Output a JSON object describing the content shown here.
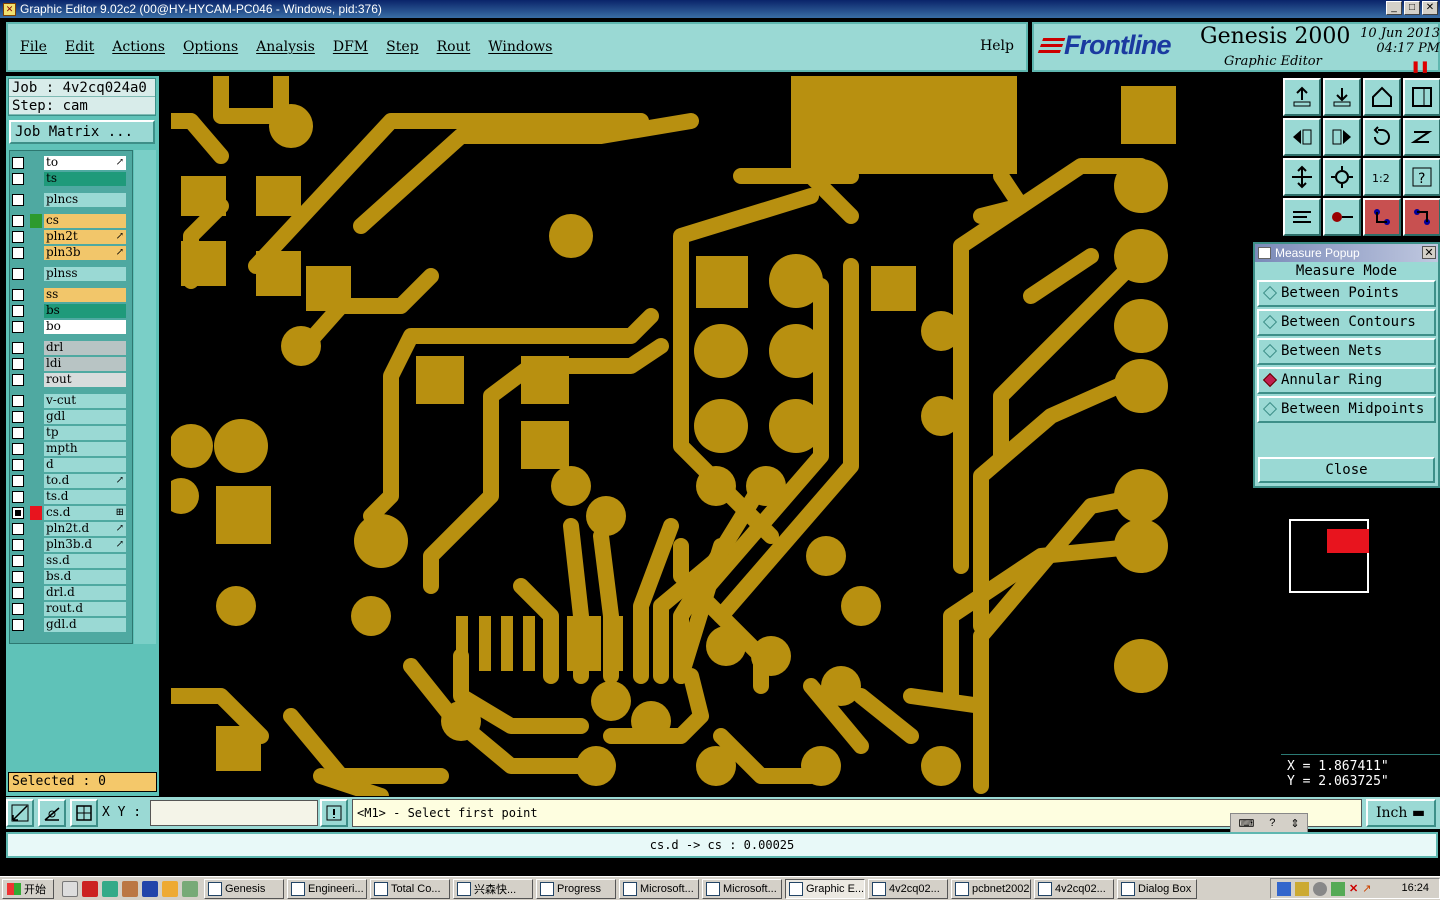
{
  "window": {
    "title": "Graphic Editor 9.02c2 (00@HY-HYCAM-PC046 - Windows, pid:376)"
  },
  "menu": {
    "items": [
      "File",
      "Edit",
      "Actions",
      "Options",
      "Analysis",
      "DFM",
      "Step",
      "Rout",
      "Windows"
    ],
    "help": "Help"
  },
  "brand": {
    "logo": "Frontline",
    "product": "Genesis 2000",
    "subtitle": "Graphic Editor",
    "date": "10 Jun 2013",
    "time": "04:17 PM"
  },
  "job": {
    "job_label": "Job : 4v2cq024a0",
    "step_label": "Step: cam",
    "matrix_button": "Job Matrix ..."
  },
  "layers": [
    {
      "name": "to",
      "color": "#ffffff",
      "checked": false,
      "swatch": "",
      "arrow": "↗"
    },
    {
      "name": "ts",
      "color": "#1f9a7a",
      "checked": false,
      "swatch": "",
      "arrow": ""
    },
    {
      "name": "plncs",
      "color": "#9ad9d4",
      "checked": false,
      "swatch": "",
      "arrow": ""
    },
    {
      "name": "cs",
      "color": "#f2c66a",
      "checked": false,
      "swatch": "#2d9a2d",
      "arrow": ""
    },
    {
      "name": "pln2t",
      "color": "#f2c66a",
      "checked": false,
      "swatch": "",
      "arrow": "↗"
    },
    {
      "name": "pln3b",
      "color": "#f2c66a",
      "checked": false,
      "swatch": "",
      "arrow": "↗"
    },
    {
      "name": "plnss",
      "color": "#9ad9d4",
      "checked": false,
      "swatch": "",
      "arrow": ""
    },
    {
      "name": "ss",
      "color": "#f2c66a",
      "checked": false,
      "swatch": "",
      "arrow": ""
    },
    {
      "name": "bs",
      "color": "#1f9a7a",
      "checked": false,
      "swatch": "",
      "arrow": ""
    },
    {
      "name": "bo",
      "color": "#ffffff",
      "checked": false,
      "swatch": "",
      "arrow": ""
    },
    {
      "name": "drl",
      "color": "#b8c4c4",
      "checked": false,
      "swatch": "",
      "arrow": ""
    },
    {
      "name": "ldi",
      "color": "#b8c4c4",
      "checked": false,
      "swatch": "",
      "arrow": ""
    },
    {
      "name": "rout",
      "color": "#d8dcdc",
      "checked": false,
      "swatch": "",
      "arrow": ""
    },
    {
      "name": "v-cut",
      "color": "#9ad9d4",
      "checked": false,
      "swatch": "",
      "arrow": ""
    },
    {
      "name": "gdl",
      "color": "#9ad9d4",
      "checked": false,
      "swatch": "",
      "arrow": ""
    },
    {
      "name": "tp",
      "color": "#9ad9d4",
      "checked": false,
      "swatch": "",
      "arrow": ""
    },
    {
      "name": "mpth",
      "color": "#9ad9d4",
      "checked": false,
      "swatch": "",
      "arrow": ""
    },
    {
      "name": "d",
      "color": "#9ad9d4",
      "checked": false,
      "swatch": "",
      "arrow": ""
    },
    {
      "name": "to.d",
      "color": "#9ad9d4",
      "checked": false,
      "swatch": "",
      "arrow": "↗"
    },
    {
      "name": "ts.d",
      "color": "#9ad9d4",
      "checked": false,
      "swatch": "",
      "arrow": ""
    },
    {
      "name": "cs.d",
      "color": "#9ad9d4",
      "checked": true,
      "swatch": "#e8141e",
      "arrow": "⊞"
    },
    {
      "name": "pln2t.d",
      "color": "#9ad9d4",
      "checked": false,
      "swatch": "",
      "arrow": "↗"
    },
    {
      "name": "pln3b.d",
      "color": "#9ad9d4",
      "checked": false,
      "swatch": "",
      "arrow": "↗"
    },
    {
      "name": "ss.d",
      "color": "#9ad9d4",
      "checked": false,
      "swatch": "",
      "arrow": ""
    },
    {
      "name": "bs.d",
      "color": "#9ad9d4",
      "checked": false,
      "swatch": "",
      "arrow": ""
    },
    {
      "name": "drl.d",
      "color": "#9ad9d4",
      "checked": false,
      "swatch": "",
      "arrow": ""
    },
    {
      "name": "rout.d",
      "color": "#9ad9d4",
      "checked": false,
      "swatch": "",
      "arrow": ""
    },
    {
      "name": "gdl.d",
      "color": "#9ad9d4",
      "checked": false,
      "swatch": "",
      "arrow": ""
    }
  ],
  "selected": "Selected : 0",
  "measure_popup": {
    "title": "Measure Popup",
    "heading": "Measure Mode",
    "options": [
      {
        "label": "Between Points",
        "selected": false
      },
      {
        "label": "Between Contours",
        "selected": false
      },
      {
        "label": "Between Nets",
        "selected": false
      },
      {
        "label": "Annular Ring",
        "selected": true
      },
      {
        "label": "Between Midpoints",
        "selected": false
      }
    ],
    "close": "Close"
  },
  "coords": {
    "x": "X = 1.867411\"",
    "y": "Y = 2.063725\""
  },
  "bottom": {
    "xy_label": "X Y :",
    "xy_value": "",
    "prompt": "<M1> - Select first point",
    "unit": "Inch"
  },
  "status_line": "cs.d -> cs : 0.00025",
  "taskbar": {
    "start": "开始",
    "items": [
      {
        "label": "Genesis",
        "active": false
      },
      {
        "label": "Engineeri...",
        "active": false
      },
      {
        "label": "Total Co...",
        "active": false
      },
      {
        "label": "兴森快...",
        "active": false
      },
      {
        "label": "Progress",
        "active": false
      },
      {
        "label": "Microsoft...",
        "active": false
      },
      {
        "label": "Microsoft...",
        "active": false
      },
      {
        "label": "Graphic E...",
        "active": true
      },
      {
        "label": "4v2cq02...",
        "active": false
      },
      {
        "label": "pcbnet2002",
        "active": false
      },
      {
        "label": "4v2cq02...",
        "active": false
      },
      {
        "label": "Dialog Box",
        "active": false
      }
    ],
    "clock": "16:24"
  },
  "colors": {
    "copper": "#b89010",
    "panel": "#9ad9d4",
    "selected_swatch": "#e8141e"
  }
}
